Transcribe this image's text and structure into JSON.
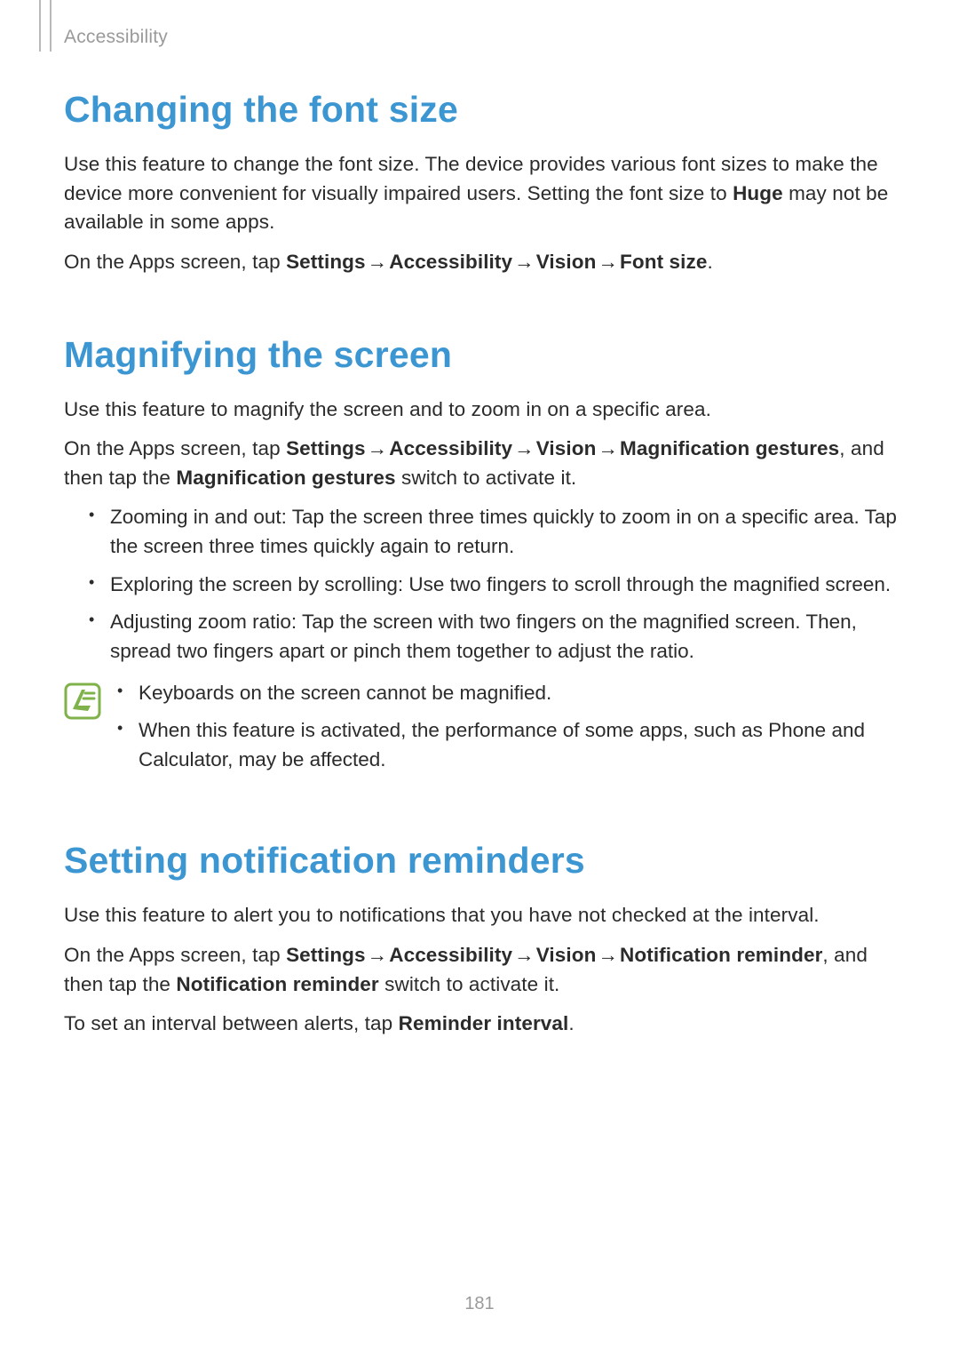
{
  "breadcrumb": "Accessibility",
  "page_number": "181",
  "arrow": "→",
  "sections": {
    "font_size": {
      "heading": "Changing the font size",
      "p1_a": "Use this feature to change the font size. The device provides various font sizes to make the device more convenient for visually impaired users. Setting the font size to ",
      "p1_b_bold": "Huge",
      "p1_c": " may not be available in some apps.",
      "p2_a": "On the Apps screen, tap ",
      "p2_b_bold": "Settings",
      "p2_c_bold": "Accessibility",
      "p2_d_bold": "Vision",
      "p2_e_bold": "Font size",
      "p2_f": "."
    },
    "magnify": {
      "heading": "Magnifying the screen",
      "p1": "Use this feature to magnify the screen and to zoom in on a specific area.",
      "p2_a": "On the Apps screen, tap ",
      "p2_b_bold": "Settings",
      "p2_c_bold": "Accessibility",
      "p2_d_bold": "Vision",
      "p2_e_bold": "Magnification gestures",
      "p2_f": ", and then tap the ",
      "p2_g_bold": "Magnification gestures",
      "p2_h": " switch to activate it.",
      "bullets": {
        "b1": "Zooming in and out: Tap the screen three times quickly to zoom in on a specific area. Tap the screen three times quickly again to return.",
        "b2": "Exploring the screen by scrolling: Use two fingers to scroll through the magnified screen.",
        "b3": "Adjusting zoom ratio: Tap the screen with two fingers on the magnified screen. Then, spread two fingers apart or pinch them together to adjust the ratio."
      },
      "note": {
        "n1": "Keyboards on the screen cannot be magnified.",
        "n2_a": "When this feature is activated, the performance of some apps, such as ",
        "n2_b_bold": "Phone",
        "n2_c": " and ",
        "n2_d_bold": "Calculator",
        "n2_e": ", may be affected."
      }
    },
    "reminders": {
      "heading": "Setting notification reminders",
      "p1": "Use this feature to alert you to notifications that you have not checked at the interval.",
      "p2_a": "On the Apps screen, tap ",
      "p2_b_bold": "Settings",
      "p2_c_bold": "Accessibility",
      "p2_d_bold": "Vision",
      "p2_e_bold": "Notification reminder",
      "p2_f": ", and then tap the ",
      "p2_g_bold": "Notification reminder",
      "p2_h": " switch to activate it.",
      "p3_a": "To set an interval between alerts, tap ",
      "p3_b_bold": "Reminder interval",
      "p3_c": "."
    }
  }
}
